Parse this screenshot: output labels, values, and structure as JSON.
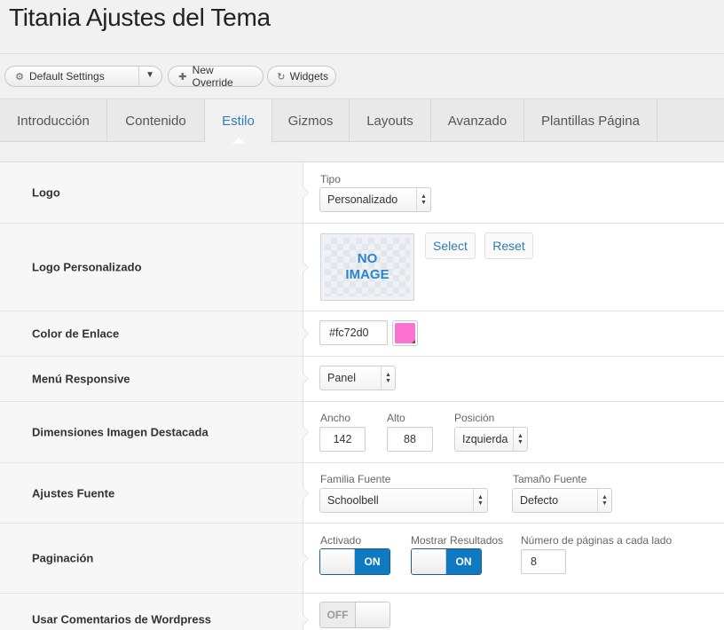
{
  "page": {
    "title": "Titania Ajustes del Tema"
  },
  "toolbar": {
    "default_settings": "Default Settings",
    "new_override": "New Override",
    "widgets": "Widgets"
  },
  "tabs": [
    {
      "label": "Introducción"
    },
    {
      "label": "Contenido"
    },
    {
      "label": "Estilo",
      "active": true
    },
    {
      "label": "Gizmos"
    },
    {
      "label": "Layouts"
    },
    {
      "label": "Avanzado"
    },
    {
      "label": "Plantillas Página"
    }
  ],
  "rows": {
    "logo": {
      "label": "Logo",
      "tipo_label": "Tipo",
      "tipo_value": "Personalizado"
    },
    "custom_logo": {
      "label": "Logo Personalizado",
      "placeholder_line1": "NO",
      "placeholder_line2": "IMAGE",
      "select": "Select",
      "reset": "Reset"
    },
    "link_color": {
      "label": "Color de Enlace",
      "value": "#fc72d0",
      "swatch_color": "#fc72d0"
    },
    "menu": {
      "label": "Menú Responsive",
      "value": "Panel"
    },
    "featured_image": {
      "label": "Dimensiones Imagen Destacada",
      "width_label": "Ancho",
      "width_value": "142",
      "height_label": "Alto",
      "height_value": "88",
      "position_label": "Posición",
      "position_value": "Izquierda"
    },
    "font": {
      "label": "Ajustes Fuente",
      "family_label": "Familia Fuente",
      "family_value": "Schoolbell",
      "size_label": "Tamaño Fuente",
      "size_value": "Defecto"
    },
    "pagination": {
      "label": "Paginación",
      "enabled_label": "Activado",
      "enabled_state": "ON",
      "show_results_label": "Mostrar Resultados",
      "show_results_state": "ON",
      "pages_label": "Número de páginas a cada lado",
      "pages_value": "8"
    },
    "wp_comments": {
      "label": "Usar Comentarios de Wordpress",
      "state": "OFF"
    }
  },
  "colors": {
    "accent": "#2a7fb8",
    "toggle_on": "#0f7ac2"
  }
}
